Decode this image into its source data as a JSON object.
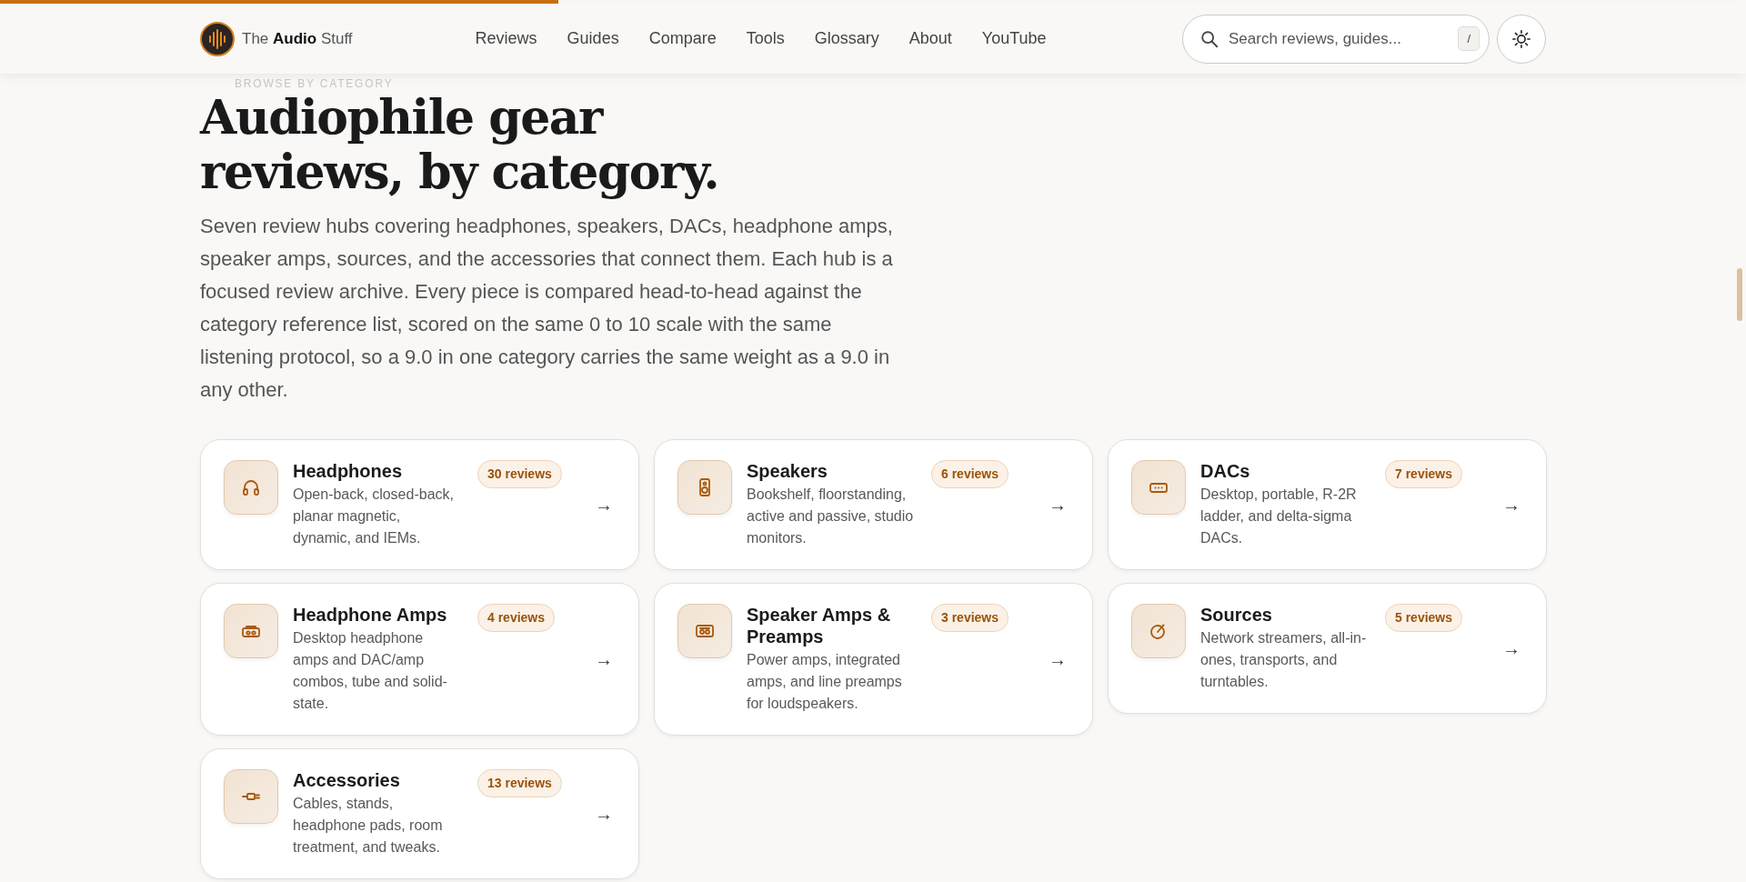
{
  "reading_progress": {
    "level": 0.32
  },
  "header": {
    "logo": {
      "prefix": "The",
      "brand": "Audio",
      "suffix": "Stuff"
    },
    "nav": [
      {
        "label": "Reviews"
      },
      {
        "label": "Guides"
      },
      {
        "label": "Compare"
      },
      {
        "label": "Tools"
      },
      {
        "label": "Glossary"
      },
      {
        "label": "About"
      },
      {
        "label": "YouTube"
      }
    ],
    "search": {
      "placeholder": "Search reviews, guides...",
      "shortcut": "/"
    }
  },
  "hero": {
    "eyebrow": "BROWSE BY CATEGORY",
    "title_lines": [
      "Audiophile gear",
      "reviews, by category."
    ],
    "intro": "Seven review hubs covering headphones, speakers, DACs, headphone amps, speaker amps, sources, and the accessories that connect them. Each hub is a focused review archive. Every piece is compared head-to-head against the category reference list, scored on the same 0 to 10 scale with the same listening protocol, so a 9.0 in one category carries the same weight as a 9.0 in any other."
  },
  "categories": [
    {
      "kind": "headphones",
      "title": "Headphones",
      "count": "30 reviews",
      "description": "Open-back, closed-back, planar magnetic, dynamic, and IEMs.",
      "arrow": "→"
    },
    {
      "kind": "speakers",
      "title": "Speakers",
      "count": "6 reviews",
      "description": "Bookshelf, floorstanding, active and passive, studio monitors.",
      "arrow": "→"
    },
    {
      "kind": "dacs",
      "title": "DACs",
      "count": "7 reviews",
      "description": "Desktop, portable, R-2R ladder, and delta-sigma DACs.",
      "arrow": "→"
    },
    {
      "kind": "headphone_amps",
      "title": "Headphone Amps",
      "count": "4 reviews",
      "description": "Desktop headphone amps and DAC/amp combos, tube and solid-state.",
      "arrow": "→"
    },
    {
      "kind": "speaker_amps",
      "title": "Speaker Amps & Preamps",
      "count": "3 reviews",
      "description": "Power amps, integrated amps, and line preamps for loudspeakers.",
      "arrow": "→"
    },
    {
      "kind": "sources",
      "title": "Sources",
      "count": "5 reviews",
      "description": "Network streamers, all-in-ones, transports, and turntables.",
      "arrow": "→"
    },
    {
      "kind": "accessories",
      "title": "Accessories",
      "count": "13 reviews",
      "description": "Cables, stands, headphone pads, room treatment, and tweaks.",
      "arrow": "→"
    }
  ]
}
